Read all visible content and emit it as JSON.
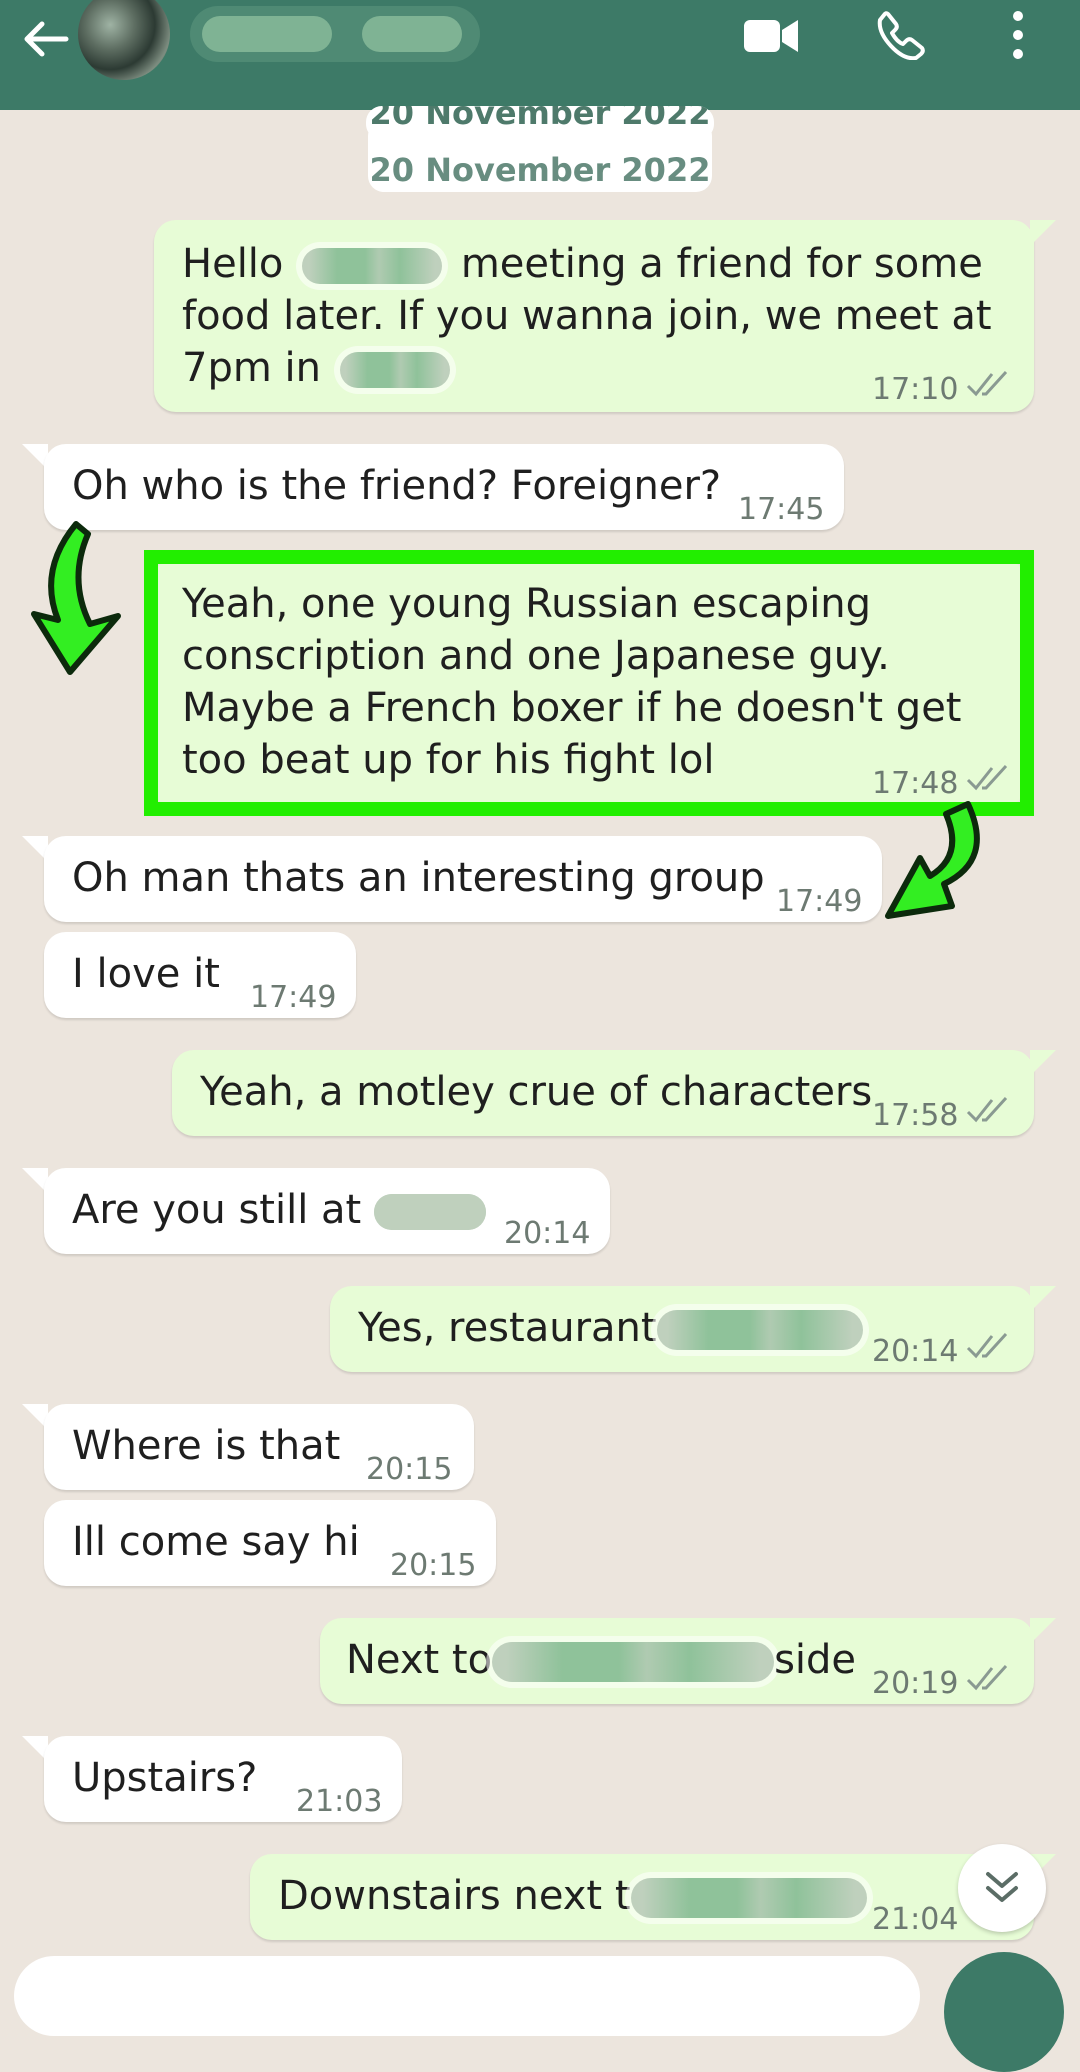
{
  "colors": {
    "header": "#3d7a67",
    "incoming": "#ffffff",
    "outgoing": "#e7fcd6",
    "highlight": "#22ee00",
    "arrow": "#33ee22"
  },
  "header": {
    "back_icon": "arrow-left-icon",
    "video_icon": "video-camera-icon",
    "call_icon": "phone-icon",
    "menu_icon": "more-vertical-icon"
  },
  "date_label": "20 November 2022",
  "messages": [
    {
      "dir": "out",
      "lines": [
        "Hello",
        "meeting a friend for some",
        "food later. If you wanna join, we meet at",
        "7pm in"
      ],
      "time": "17:10"
    },
    {
      "dir": "in",
      "text": "Oh who is the friend? Foreigner?",
      "time": "17:45"
    },
    {
      "dir": "out",
      "lines": [
        "Yeah, one young Russian escaping",
        "conscription and one Japanese guy.",
        "Maybe a French boxer if he doesn't get",
        "too beat up for his fight lol"
      ],
      "time": "17:48"
    },
    {
      "dir": "in",
      "text": "Oh man thats an interesting group",
      "time": "17:49"
    },
    {
      "dir": "in",
      "text": "I love it",
      "time": "17:49"
    },
    {
      "dir": "out",
      "text": "Yeah, a motley crue of characters",
      "time": "17:58"
    },
    {
      "dir": "in",
      "text": "Are you still at",
      "time": "20:14"
    },
    {
      "dir": "out",
      "text": "Yes, restaurant",
      "time": "20:14"
    },
    {
      "dir": "in",
      "text": "Where is that",
      "time": "20:15"
    },
    {
      "dir": "in",
      "text": "Ill come say hi",
      "time": "20:15"
    },
    {
      "dir": "out",
      "text_before": "Next to",
      "text_after": "side",
      "time": "20:19"
    },
    {
      "dir": "in",
      "text": "Upstairs?",
      "time": "21:03"
    },
    {
      "dir": "out",
      "text": "Downstairs next t",
      "time": "21:04"
    }
  ],
  "scroll_button_icon": "double-chevron-down-icon"
}
